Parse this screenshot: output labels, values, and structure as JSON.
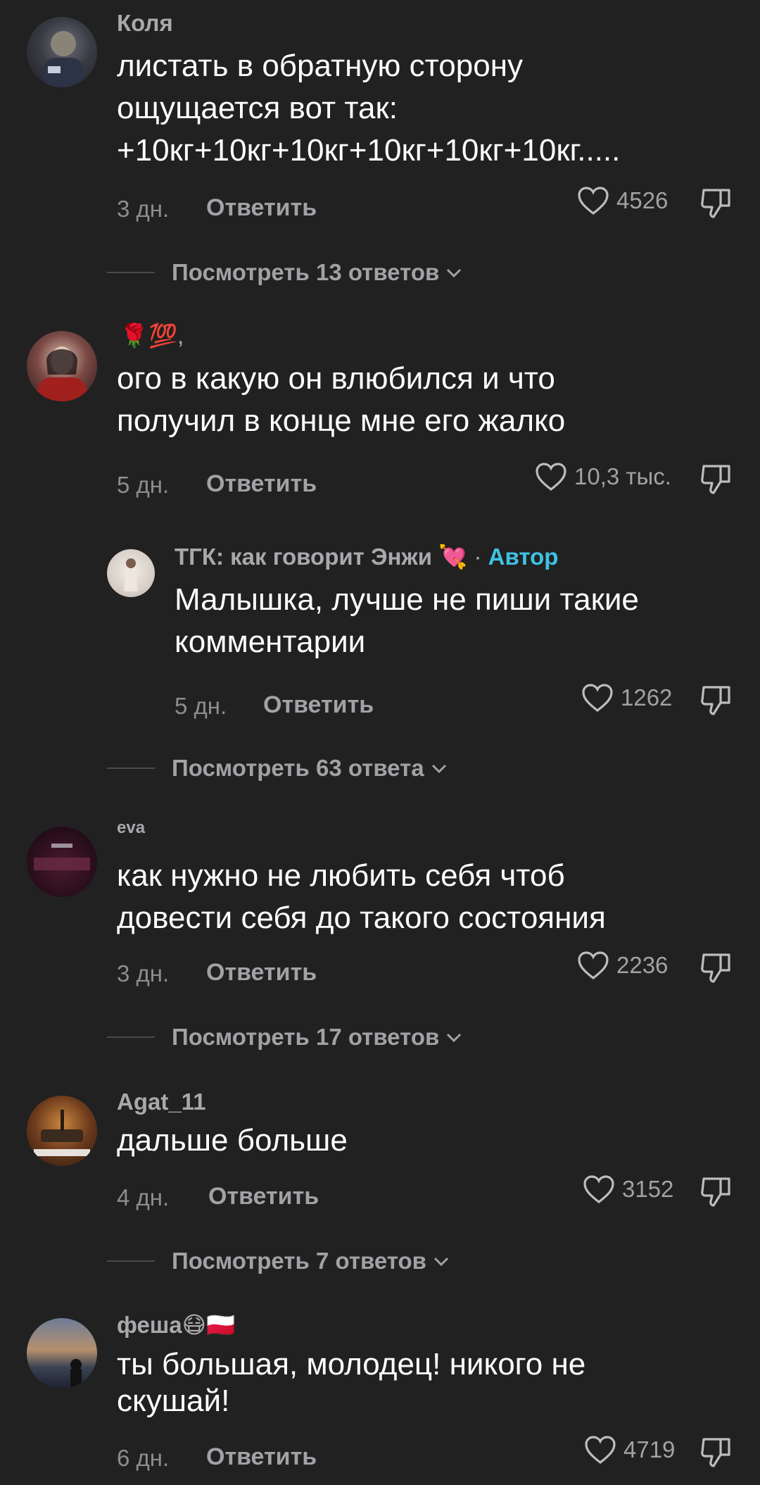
{
  "colors": {
    "background": "#212121",
    "author_badge": "#3fc2e4",
    "muted_text": "#a2a2a6"
  },
  "comments": [
    {
      "author": "Коля",
      "text_lines": [
        "листать в обратную сторону",
        "ощущается вот так:",
        "+10кг+10кг+10кг+10кг+10кг+10кг....."
      ],
      "time": "3 дн.",
      "reply_label": "Ответить",
      "likes": "4526",
      "view_replies": "Посмотреть 13 ответов"
    },
    {
      "author": "🌹💯,",
      "text_lines": [
        "ого в какую он влюбился и что",
        "получил в конце мне его жалко"
      ],
      "time": "5 дн.",
      "reply_label": "Ответить",
      "likes": "10,3 тыс.",
      "reply": {
        "author": "ТГК: как говорит Энжи 💘",
        "separator": "·",
        "badge": "Автор",
        "text_lines": [
          "Малышка, лучше не пиши такие",
          "комментарии"
        ],
        "time": "5 дн.",
        "reply_label": "Ответить",
        "likes": "1262"
      },
      "view_replies": "Посмотреть 63 ответа"
    },
    {
      "author": "eva",
      "text_lines": [
        "как нужно не любить себя чтоб",
        "довести себя до такого состояния"
      ],
      "time": "3 дн.",
      "reply_label": "Ответить",
      "likes": "2236",
      "view_replies": "Посмотреть 17 ответов"
    },
    {
      "author": "Agat_11",
      "text_lines": [
        "дальше больше"
      ],
      "time": "4 дн.",
      "reply_label": "Ответить",
      "likes": "3152",
      "view_replies": "Посмотреть 7 ответов"
    },
    {
      "author": "феша😷🇵🇱",
      "text_lines": [
        "ты большая, молодец! никого не",
        "скушай!"
      ],
      "time": "6 дн.",
      "reply_label": "Ответить",
      "likes": "4719"
    }
  ]
}
